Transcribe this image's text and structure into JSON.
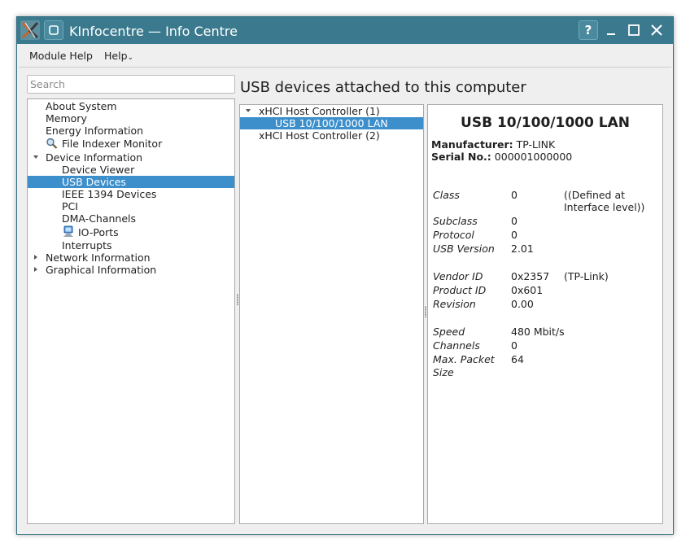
{
  "window": {
    "title": "KInfocentre — Info Centre",
    "help_button": "?",
    "minimize_button": "_",
    "maximize_button": "□",
    "close_button": "✕"
  },
  "menubar": {
    "items": [
      "Module Help",
      "Help"
    ]
  },
  "search": {
    "placeholder": "Search",
    "value": ""
  },
  "sidebar": {
    "items": [
      {
        "label": "About System"
      },
      {
        "label": "Memory"
      },
      {
        "label": "Energy Information"
      },
      {
        "label": "File Indexer Monitor",
        "icon": "magnifier-icon"
      },
      {
        "label": "Device Information",
        "expanded": true
      },
      {
        "label": "Device Viewer"
      },
      {
        "label": "USB Devices",
        "selected": true
      },
      {
        "label": "IEEE 1394 Devices"
      },
      {
        "label": "PCI"
      },
      {
        "label": "DMA-Channels"
      },
      {
        "label": "IO-Ports",
        "icon": "io-ports-icon"
      },
      {
        "label": "Interrupts"
      },
      {
        "label": "Network Information",
        "expanded": false
      },
      {
        "label": "Graphical Information",
        "expanded": false
      }
    ]
  },
  "page": {
    "heading": "USB devices attached to this computer"
  },
  "usb_tree": {
    "items": [
      {
        "label": "xHCI Host Controller (1)",
        "expanded": true
      },
      {
        "label": "USB 10/100/1000 LAN",
        "selected": true
      },
      {
        "label": "xHCI Host Controller (2)"
      }
    ]
  },
  "details": {
    "title": "USB 10/100/1000 LAN",
    "manufacturer_label": "Manufacturer:",
    "manufacturer": "TP-LINK",
    "serial_label": "Serial No.:",
    "serial": "000001000000",
    "props": [
      {
        "label": "Class",
        "value": "0",
        "extra": "((Defined at Interface level))"
      },
      {
        "label": "Subclass",
        "value": "0"
      },
      {
        "label": "Protocol",
        "value": "0"
      },
      {
        "label": "USB Version",
        "value": "2.01"
      },
      {
        "label": "Vendor ID",
        "value": "0x2357",
        "extra": "(TP-Link)"
      },
      {
        "label": "Product ID",
        "value": "0x601"
      },
      {
        "label": "Revision",
        "value": "0.00"
      },
      {
        "label": "Speed",
        "value": "480 Mbit/s"
      },
      {
        "label": "Channels",
        "value": "0"
      },
      {
        "label": "Max. Packet Size",
        "value": "64"
      }
    ]
  },
  "colors": {
    "titlebar": "#3b7a8e",
    "selection": "#3d8fcc"
  }
}
